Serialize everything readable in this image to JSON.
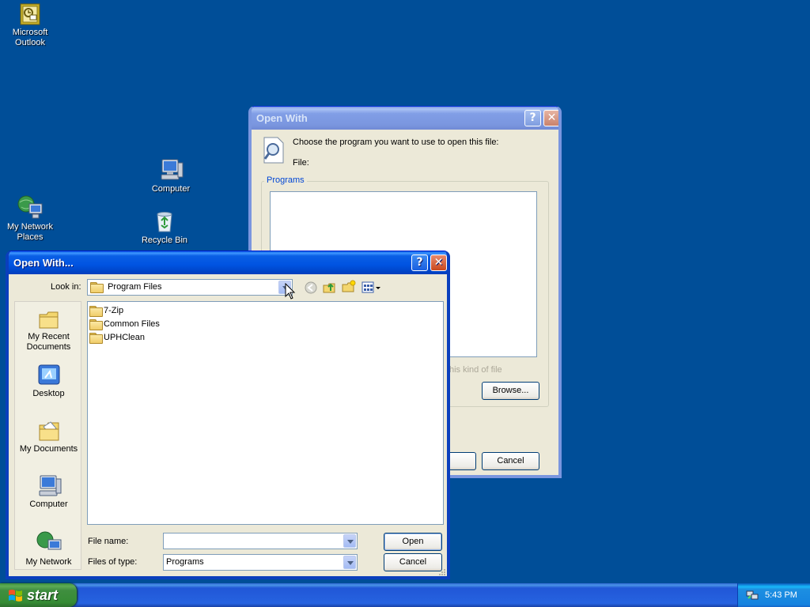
{
  "desktop": {
    "icons": [
      {
        "label_l1": "Microsoft",
        "label_l2": "Outlook",
        "icon": "outlook-icon"
      },
      {
        "label": "Computer",
        "icon": "computer-icon"
      },
      {
        "label": "Recycle Bin",
        "icon": "recycle-bin-icon"
      },
      {
        "label_l1": "My Network",
        "label_l2": "Places",
        "icon": "network-places-icon"
      }
    ]
  },
  "bg_dialog": {
    "title": "Open With",
    "prompt": "Choose the program you want to use to open this file:",
    "file_label": "File:",
    "programs_group": "Programs",
    "always_text_fragment": "his kind of file",
    "browse_label": "Browse...",
    "cancel_label": "Cancel"
  },
  "file_dialog": {
    "title": "Open With...",
    "look_in_label": "Look in:",
    "look_in_value": "Program Files",
    "places": [
      {
        "l1": "My Recent",
        "l2": "Documents",
        "icon": "recent-documents-icon"
      },
      {
        "l1": "Desktop",
        "l2": "",
        "icon": "desktop-icon"
      },
      {
        "l1": "My Documents",
        "l2": "",
        "icon": "my-documents-icon"
      },
      {
        "l1": "Computer",
        "l2": "",
        "icon": "computer-icon"
      },
      {
        "l1": "My Network",
        "l2": "",
        "icon": "network-icon"
      }
    ],
    "files": [
      "7-Zip",
      "Common Files",
      "UPHClean"
    ],
    "file_name_label": "File name:",
    "file_name_value": "",
    "files_of_type_label": "Files of type:",
    "files_of_type_value": "Programs",
    "open_label": "Open",
    "cancel_label": "Cancel"
  },
  "taskbar": {
    "start_label": "start",
    "clock": "5:43 PM"
  },
  "colors": {
    "desktop": "#004e98",
    "title_active": "#0053e1",
    "dialog_face": "#ece9d8"
  }
}
